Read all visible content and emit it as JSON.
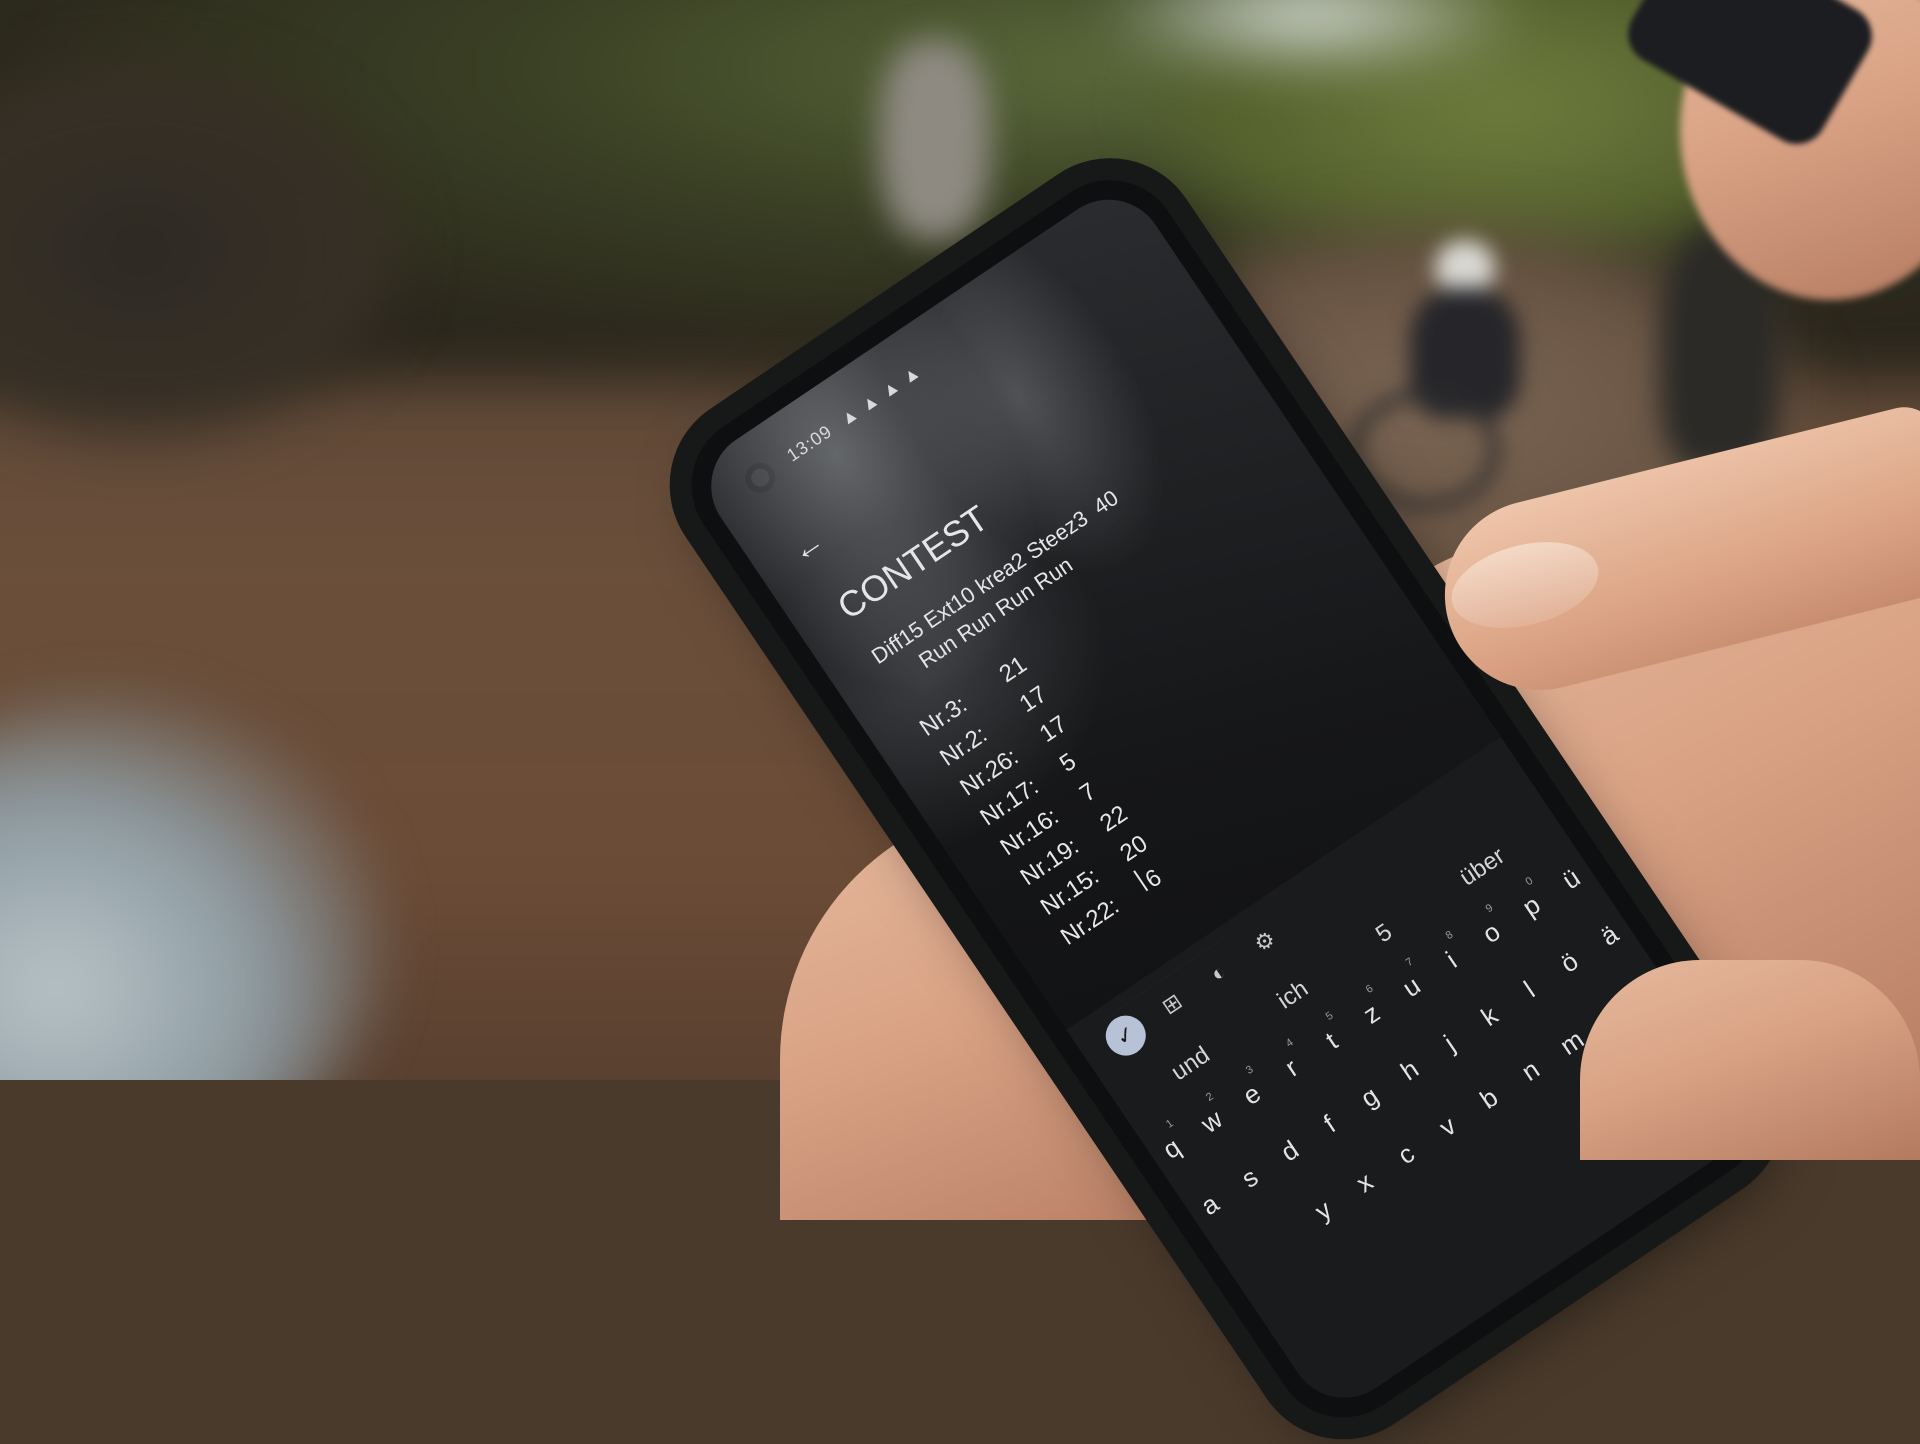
{
  "status": {
    "time": "13:09"
  },
  "note": {
    "title": "CONTEST",
    "header_line1": "Diff15 Ext10 krea2 Steez3  40",
    "header_line2": "      Run Run Run Run",
    "rows": [
      {
        "label": "Nr.3:",
        "value": "21"
      },
      {
        "label": "Nr.2:",
        "value": "17"
      },
      {
        "label": "Nr.26:",
        "value": "17"
      },
      {
        "label": "Nr.17:",
        "value": "5"
      },
      {
        "label": "Nr.16:",
        "value": "7"
      },
      {
        "label": "Nr.19:",
        "value": "22"
      },
      {
        "label": "Nr.15:",
        "value": "20"
      },
      {
        "label": "Nr.22:",
        "value": "6"
      }
    ]
  },
  "keyboard": {
    "suggestions": [
      "und",
      "ich",
      "5",
      "über"
    ],
    "row1": [
      "q",
      "w",
      "e",
      "r",
      "t",
      "z",
      "u",
      "i",
      "o",
      "p",
      "ü"
    ],
    "row1_nums": [
      "1",
      "2",
      "3",
      "4",
      "5",
      "6",
      "7",
      "8",
      "9",
      "0",
      ""
    ],
    "row2": [
      "a",
      "s",
      "d",
      "f",
      "g",
      "h",
      "j",
      "k",
      "l",
      "ö",
      "ä"
    ],
    "row3": [
      "y",
      "x",
      "c",
      "v",
      "b",
      "n",
      "m"
    ]
  },
  "icons": [
    "back-arrow-icon",
    "camera-icon",
    "sticker-icon",
    "palette-icon",
    "settings-icon",
    "check-icon"
  ]
}
